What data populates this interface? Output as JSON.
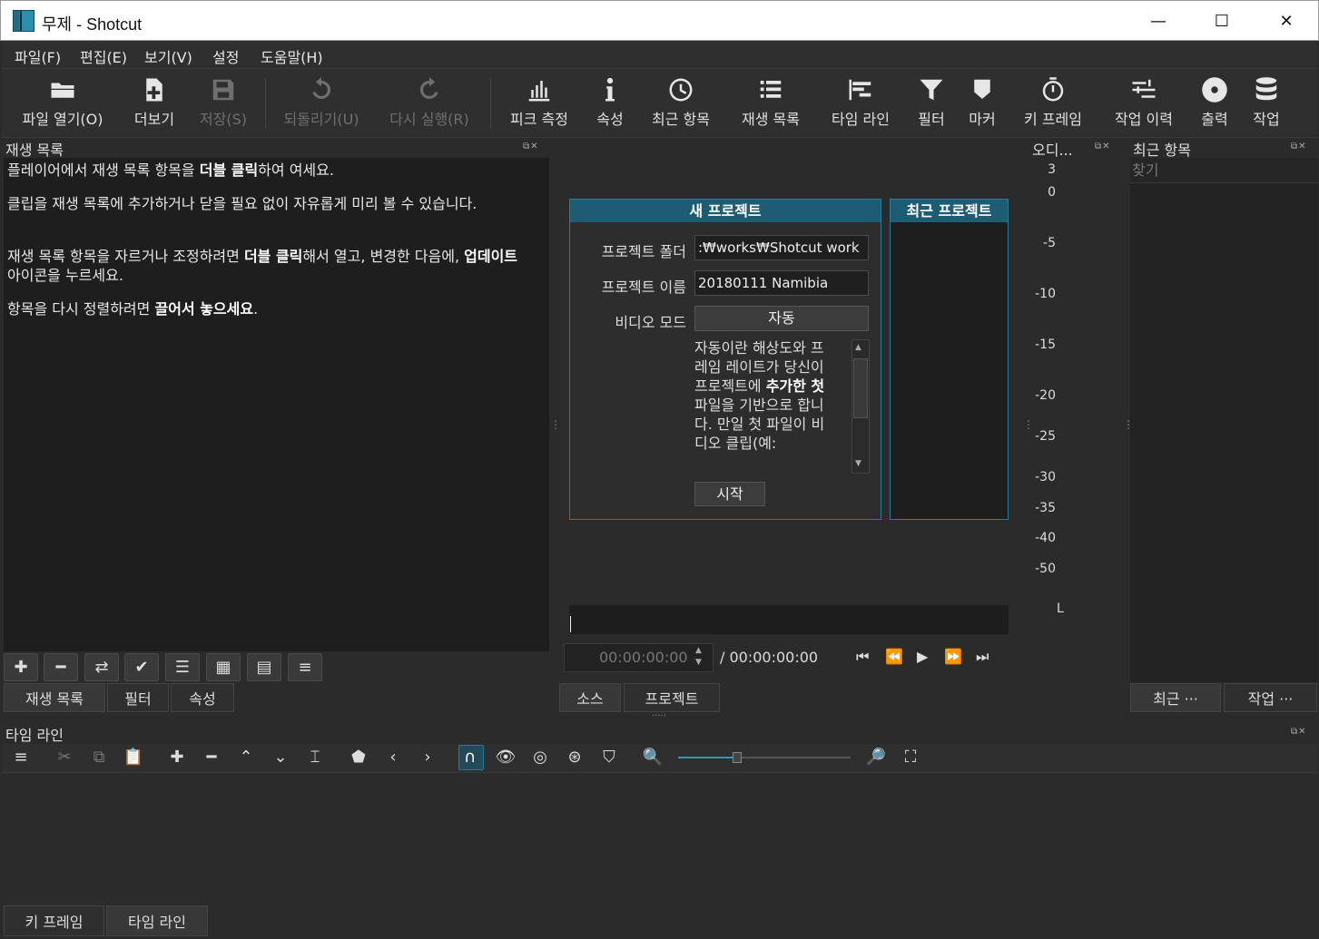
{
  "window": {
    "title": "무제 - Shotcut",
    "minimize": "—",
    "maximize": "☐",
    "close": "✕"
  },
  "menu": [
    "파일(F)",
    "편집(E)",
    "보기(V)",
    "설정",
    "도움말(H)"
  ],
  "toolbar": [
    {
      "label": "파일 열기(O)",
      "icon": "folder-open-icon",
      "enabled": true
    },
    {
      "label": "더보기",
      "icon": "add-file-icon",
      "enabled": true
    },
    {
      "label": "저장(S)",
      "icon": "save-icon",
      "enabled": false
    },
    {
      "label": "되돌리기(U)",
      "icon": "undo-icon",
      "enabled": false
    },
    {
      "label": "다시 실행(R)",
      "icon": "redo-icon",
      "enabled": false
    },
    {
      "label": "피크 측정",
      "icon": "peak-meter-icon",
      "enabled": true
    },
    {
      "label": "속성",
      "icon": "info-icon",
      "enabled": true
    },
    {
      "label": "최근 항목",
      "icon": "clock-icon",
      "enabled": true
    },
    {
      "label": "재생 목록",
      "icon": "list-icon",
      "enabled": true
    },
    {
      "label": "타임 라인",
      "icon": "timeline-icon",
      "enabled": true
    },
    {
      "label": "필터",
      "icon": "filter-icon",
      "enabled": true
    },
    {
      "label": "마커",
      "icon": "marker-icon",
      "enabled": true
    },
    {
      "label": "키 프레임",
      "icon": "stopwatch-icon",
      "enabled": true
    },
    {
      "label": "작업 이력",
      "icon": "history-icon",
      "enabled": true
    },
    {
      "label": "출력",
      "icon": "disc-icon",
      "enabled": true
    },
    {
      "label": "작업",
      "icon": "database-icon",
      "enabled": true
    }
  ],
  "playlist": {
    "title": "재생 목록",
    "lines": [
      [
        "플레이어에서 재생 목록 항목을 ",
        "더블 클릭",
        "하여 여세요."
      ],
      [
        "클립을 재생 목록에 추가하거나 닫을 필요 없이 자유롭게 미리 볼 수 있습니다.",
        "",
        ""
      ],
      [
        "재생 목록 항목을 자르거나 조정하려면 ",
        "더블 클릭",
        "해서 열고, 변경한 다음에, "
      ],
      [
        "항목을 다시 정렬하려면 ",
        "끌어서 놓으세요",
        "."
      ]
    ],
    "line3_tail_bold": "업데이트",
    "line3_tail": " 아이콘을 누르세요.",
    "tabs": [
      "재생 목록",
      "필터",
      "속성"
    ]
  },
  "new_project": {
    "header": "새 프로젝트",
    "folder_label": "프로젝트 폴더",
    "folder_value": ":₩works₩Shotcut work",
    "name_label": "프로젝트 이름",
    "name_value": "20180111 Namibia",
    "mode_label": "비디오 모드",
    "mode_value": "자동",
    "desc_1": "자동이란 해상도와 프레임 레이트가 당신이 프로젝트에 ",
    "desc_bold": "추가한 첫",
    "desc_2": " 파일을 기반으로 합니다. 만일 첫 파일이 비디오 클립(예:",
    "start": "시작"
  },
  "recent_projects": {
    "header": "최근 프로젝트"
  },
  "player": {
    "timecode": "00:00:00:00",
    "duration": "/ 00:00:00:00",
    "tabs": [
      "소스",
      "프로젝트"
    ]
  },
  "audio": {
    "title": "오디...",
    "scale": [
      "3",
      "0",
      "-5",
      "-10",
      "-15",
      "-20",
      "-25",
      "-30",
      "-35",
      "-40",
      "-50"
    ],
    "channel": "L"
  },
  "recent": {
    "title": "최근 항목",
    "search_placeholder": "찾기",
    "tabs": [
      "최근 ···",
      "작업 ···"
    ]
  },
  "timeline": {
    "title": "타임 라인",
    "tabs": [
      "키 프레임",
      "타임 라인"
    ]
  }
}
